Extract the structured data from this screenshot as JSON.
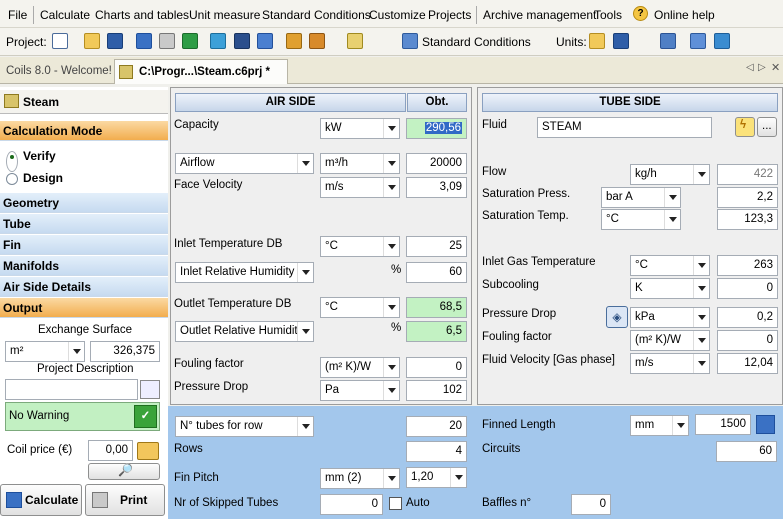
{
  "menu": [
    "File",
    "Calculate",
    "Charts and tables",
    "Unit measure",
    "Standard Conditions",
    "Customize",
    "Projects",
    "Archive management",
    "Tools",
    "Online help"
  ],
  "toolbar": {
    "project_label": "Project:",
    "std_conditions": "Standard Conditions",
    "units_label": "Units:"
  },
  "tabs": {
    "welcome": "Coils 8.0 - Welcome!",
    "active": "C:\\Progr...\\Steam.c6prj *"
  },
  "sidebar": {
    "title": "Steam",
    "calc_mode": "Calculation Mode",
    "verify": "Verify",
    "design": "Design",
    "items": [
      "Geometry",
      "Tube",
      "Fin",
      "Manifolds",
      "Air Side Details"
    ],
    "output": "Output",
    "exchange_surface_label": "Exchange Surface",
    "exchange_unit": "m²",
    "exchange_value": "326,375",
    "project_desc_label": "Project Description",
    "project_desc_value": "",
    "warning": "No Warning",
    "coil_price_label": "Coil price (€)",
    "coil_price_value": "0,00",
    "calculate": "Calculate",
    "print": "Print"
  },
  "air": {
    "header": "AIR SIDE",
    "obt_header": "Obt.",
    "capacity_label": "Capacity",
    "capacity_unit": "kW",
    "capacity_value": "290,56",
    "airflow_select": "Airflow",
    "airflow_unit": "m³/h",
    "airflow_value": "20000",
    "face_velocity_label": "Face Velocity",
    "face_velocity_unit": "m/s",
    "face_velocity_value": "3,09",
    "inlet_temp_label": "Inlet Temperature DB",
    "inlet_temp_unit": "°C",
    "inlet_temp_value": "25",
    "inlet_rh_select": "Inlet Relative Humidity",
    "inlet_rh_unit": "%",
    "inlet_rh_value": "60",
    "outlet_temp_label": "Outlet Temperature DB",
    "outlet_temp_unit": "°C",
    "outlet_temp_value": "68,5",
    "outlet_rh_select": "Outlet Relative Humidity",
    "outlet_rh_unit": "%",
    "outlet_rh_value": "6,5",
    "fouling_label": "Fouling factor",
    "fouling_unit": "(m² K)/W",
    "fouling_value": "0",
    "pressure_drop_label": "Pressure Drop",
    "pressure_drop_unit": "Pa",
    "pressure_drop_value": "102"
  },
  "tube": {
    "header": "TUBE SIDE",
    "fluid_label": "Fluid",
    "fluid_value": "STEAM",
    "more_button": "...",
    "flow_label": "Flow",
    "flow_unit": "kg/h",
    "flow_value": "422",
    "sat_press_label": "Saturation Press.",
    "sat_press_unit": "bar A",
    "sat_press_value": "2,2",
    "sat_temp_label": "Saturation Temp.",
    "sat_temp_unit": "°C",
    "sat_temp_value": "123,3",
    "inlet_gas_label": "Inlet Gas Temperature",
    "inlet_gas_unit": "°C",
    "inlet_gas_value": "263",
    "subcooling_label": "Subcooling",
    "subcooling_unit": "K",
    "subcooling_value": "0",
    "pressure_drop_label": "Pressure Drop",
    "pressure_drop_unit": "kPa",
    "pressure_drop_value": "0,2",
    "fouling_label": "Fouling factor",
    "fouling_unit": "(m² K)/W",
    "fouling_value": "0",
    "fluid_velocity_label": "Fluid Velocity [Gas phase]",
    "fluid_velocity_unit": "m/s",
    "fluid_velocity_value": "12,04"
  },
  "geometry": {
    "tubes_row_select": "N° tubes for row",
    "tubes_row_value": "20",
    "rows_label": "Rows",
    "rows_value": "4",
    "fin_pitch_label": "Fin Pitch",
    "fin_pitch_unit": "mm (2)",
    "fin_pitch_value": "1,20",
    "skipped_label": "Nr of Skipped Tubes",
    "skipped_value": "0",
    "auto_label": "Auto",
    "finned_length_label": "Finned Length",
    "finned_length_unit": "mm",
    "finned_length_value": "1500",
    "circuits_label": "Circuits",
    "circuits_value": "60",
    "baffles_label": "Baffles n°",
    "baffles_value": "0"
  },
  "colors": {
    "accent_orange": "#f2ad4e",
    "obtained_green": "#c3f2c3",
    "bottom_panel": "#a3c7ec",
    "selection_blue": "#3169c6"
  }
}
